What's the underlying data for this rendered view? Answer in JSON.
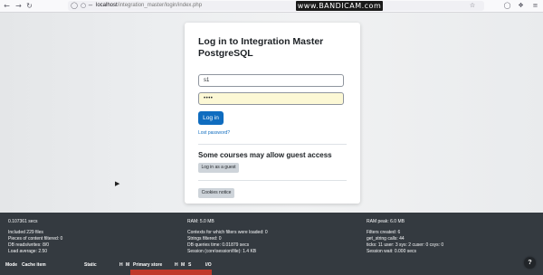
{
  "browser": {
    "url_host": "localhost",
    "url_path": "/integration_master/login/index.php",
    "watermark": "www.BANDICAM.com"
  },
  "login": {
    "title": "Log in to Integration Master PostgreSQL",
    "username_value": "s1",
    "password_value": "••••",
    "login_button": "Log in",
    "lost_password": "Lost password?",
    "guest_heading": "Some courses may allow guest access",
    "guest_button": "Log in as a guest",
    "cookies_button": "Cookies notice"
  },
  "perf": {
    "time": "0.107361 secs",
    "ram": "RAM: 5.0 MB",
    "ram_peak": "RAM peak: 6.0 MB",
    "included_files": "Included 229 files",
    "contexts": "Contexts for which filters were loaded: 0",
    "filters_created": "Filters created: 6",
    "pieces_filtered": "Pieces of content filtered: 0",
    "strings_filtered": "Strings filtered: 0",
    "get_string": "get_string calls: 44",
    "db_rw": "DB reads/writes: 8/0",
    "db_time": "DB queries time: 0.01879 secs",
    "ticks": "ticks: 11 user: 3 sys: 2 cuser: 0 csys: 0",
    "load_avg": "Load average: 2.50",
    "session": "Session (core\\session\\file): 1.4 KB",
    "session_wait": "Session wait: 0.000 secs"
  },
  "cache_table": {
    "headers": [
      "Mode",
      "Cache item",
      "Static",
      "H",
      "M",
      "Primary store",
      "H",
      "M",
      "S",
      "I/O"
    ]
  },
  "help": {
    "label": "?"
  }
}
